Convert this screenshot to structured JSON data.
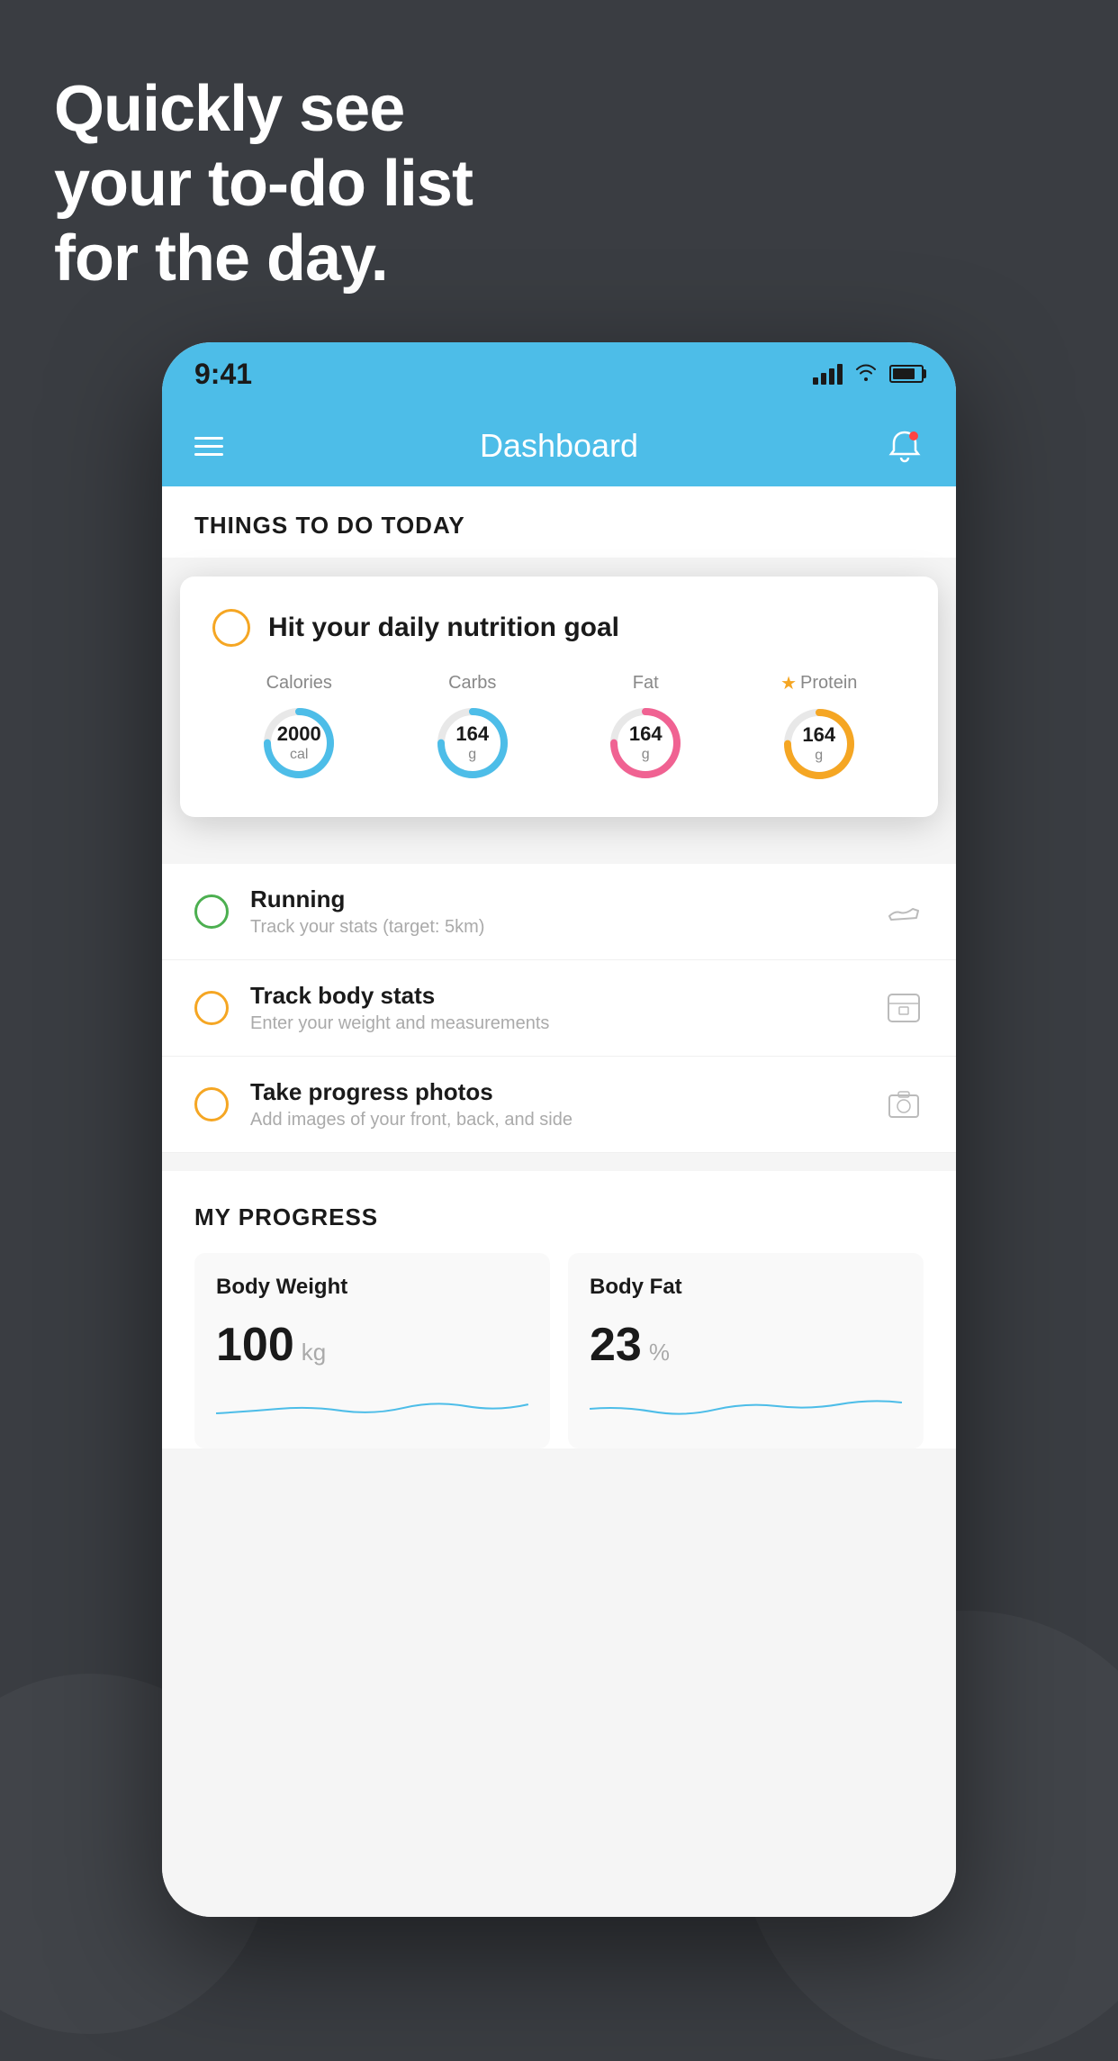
{
  "headline": {
    "line1": "Quickly see",
    "line2": "your to-do list",
    "line3": "for the day."
  },
  "statusBar": {
    "time": "9:41"
  },
  "header": {
    "title": "Dashboard"
  },
  "sectionTodoTitle": "THINGS TO DO TODAY",
  "nutritionCard": {
    "title": "Hit your daily nutrition goal",
    "macros": [
      {
        "label": "Calories",
        "value": "2000",
        "unit": "cal",
        "color": "blue"
      },
      {
        "label": "Carbs",
        "value": "164",
        "unit": "g",
        "color": "blue"
      },
      {
        "label": "Fat",
        "value": "164",
        "unit": "g",
        "color": "pink"
      },
      {
        "label": "Protein",
        "value": "164",
        "unit": "g",
        "color": "yellow",
        "starred": true
      }
    ]
  },
  "todoItems": [
    {
      "title": "Running",
      "subtitle": "Track your stats (target: 5km)",
      "checkType": "green",
      "iconType": "shoe"
    },
    {
      "title": "Track body stats",
      "subtitle": "Enter your weight and measurements",
      "checkType": "yellow",
      "iconType": "scale"
    },
    {
      "title": "Take progress photos",
      "subtitle": "Add images of your front, back, and side",
      "checkType": "yellow",
      "iconType": "photo"
    }
  ],
  "progressSection": {
    "title": "MY PROGRESS",
    "cards": [
      {
        "title": "Body Weight",
        "value": "100",
        "unit": "kg"
      },
      {
        "title": "Body Fat",
        "value": "23",
        "unit": "%"
      }
    ]
  }
}
